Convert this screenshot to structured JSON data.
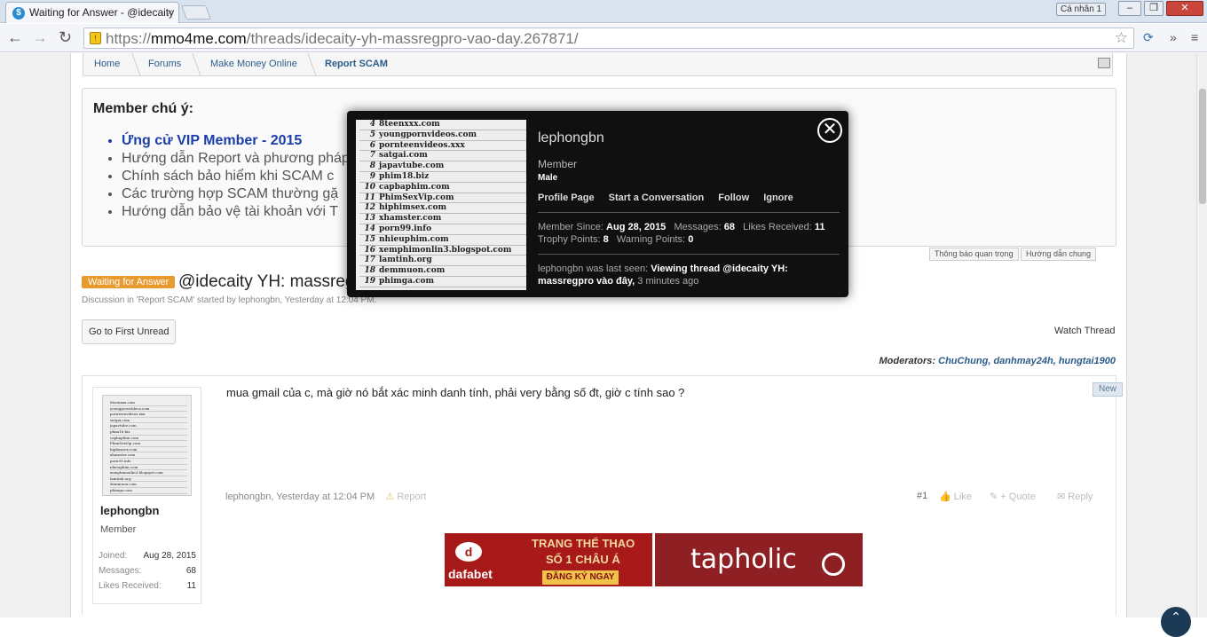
{
  "browser": {
    "tab_title": "Waiting for Answer - @idecaity",
    "tab_close": "×",
    "profile_label": "Cá nhân 1",
    "url_scheme": "https://",
    "url_host": "mmo4me.com",
    "url_path": "/threads/idecaity-yh-massregpro-vao-day.267871/",
    "win_min": "–",
    "win_max": "❐",
    "win_close": "✕"
  },
  "breadcrumb": [
    "Home",
    "Forums",
    "Make Money Online",
    "Report SCAM"
  ],
  "notice": {
    "title": "Member chú ý:",
    "items": [
      "Ứng cử VIP Member - 2015",
      "Hướng dẫn Report và phương pháp",
      "Chính sách bảo hiểm khi SCAM c",
      "Các trường hợp SCAM thường gặ",
      "Hướng dẫn bảo vệ tài khoản với T"
    ]
  },
  "notice_tags": [
    "Thông báo quan trọng",
    "Hướng dẫn chung"
  ],
  "thread": {
    "status": "Waiting for Answer",
    "title": "@idecaity YH: massregpro",
    "discussion": "Discussion in 'Report SCAM' started by lephongbn, Yesterday at 12:04 PM.",
    "go_first_unread": "Go to First Unread",
    "watch": "Watch Thread",
    "moderators_label": "Moderators:",
    "moderators": "ChuChung, danhmay24h, hungtai1900"
  },
  "post": {
    "username": "lephongbn",
    "role": "Member",
    "stats": [
      {
        "label": "Joined:",
        "value": "Aug 28, 2015"
      },
      {
        "label": "Messages:",
        "value": "68"
      },
      {
        "label": "Likes Received:",
        "value": "11"
      }
    ],
    "message": "mua gmail của c, mà giờ nó bắt xác minh danh tính, phải very bằng số đt, giờ c tính sao ?",
    "new_badge": "New",
    "footer": "lephongbn, Yesterday at 12:04 PM",
    "report": "Report",
    "number": "#1",
    "like": "Like",
    "quote": "+ Quote",
    "reply": "Reply"
  },
  "avatar_list": [
    {
      "n": "4",
      "t": "8teenxxx.com"
    },
    {
      "n": "5",
      "t": "youngpornvideos.com"
    },
    {
      "n": "6",
      "t": "pornteenvideos.xxx"
    },
    {
      "n": "7",
      "t": "satgai.com"
    },
    {
      "n": "8",
      "t": "japavtube.com"
    },
    {
      "n": "9",
      "t": "phim18.biz"
    },
    {
      "n": "10",
      "t": "capbaphim.com"
    },
    {
      "n": "11",
      "t": "PhimSexVip.com"
    },
    {
      "n": "12",
      "t": "hiphimsex.com"
    },
    {
      "n": "13",
      "t": "xhamster.com"
    },
    {
      "n": "14",
      "t": "porn99.info"
    },
    {
      "n": "15",
      "t": "nhieuphim.com"
    },
    {
      "n": "16",
      "t": "xemphimonlin3.blogspot.com"
    },
    {
      "n": "17",
      "t": "lamtinh.org"
    },
    {
      "n": "18",
      "t": "demmuon.com"
    },
    {
      "n": "19",
      "t": "phimga.com"
    }
  ],
  "banners": {
    "dafabet_brand": "dafabet",
    "dafabet_line1": "TRANG THỂ THAO",
    "dafabet_line2": "SỐ 1 CHÂU Á",
    "dafabet_cta": "ĐĂNG KÝ NGAY",
    "tapholic_brand": "tapholic"
  },
  "popup": {
    "name": "lephongbn",
    "role": "Member",
    "gender": "Male",
    "links": [
      "Profile Page",
      "Start a Conversation",
      "Follow",
      "Ignore"
    ],
    "member_since_label": "Member Since:",
    "member_since": "Aug 28, 2015",
    "messages_label": "Messages:",
    "messages": "68",
    "likes_label": "Likes Received:",
    "likes": "11",
    "trophy_label": "Trophy Points:",
    "trophy": "8",
    "warning_label": "Warning Points:",
    "warning": "0",
    "seen_prefix": "lephongbn was last seen:",
    "seen_activity": "Viewing thread @idecaity YH: massregpro vào đây,",
    "seen_time": "3 minutes ago",
    "close": "✕"
  },
  "colors": {
    "waiting": "#e99a2f",
    "link": "#2b5c8a",
    "vip": "#1a3ea8",
    "popup_bg": "#101010"
  }
}
